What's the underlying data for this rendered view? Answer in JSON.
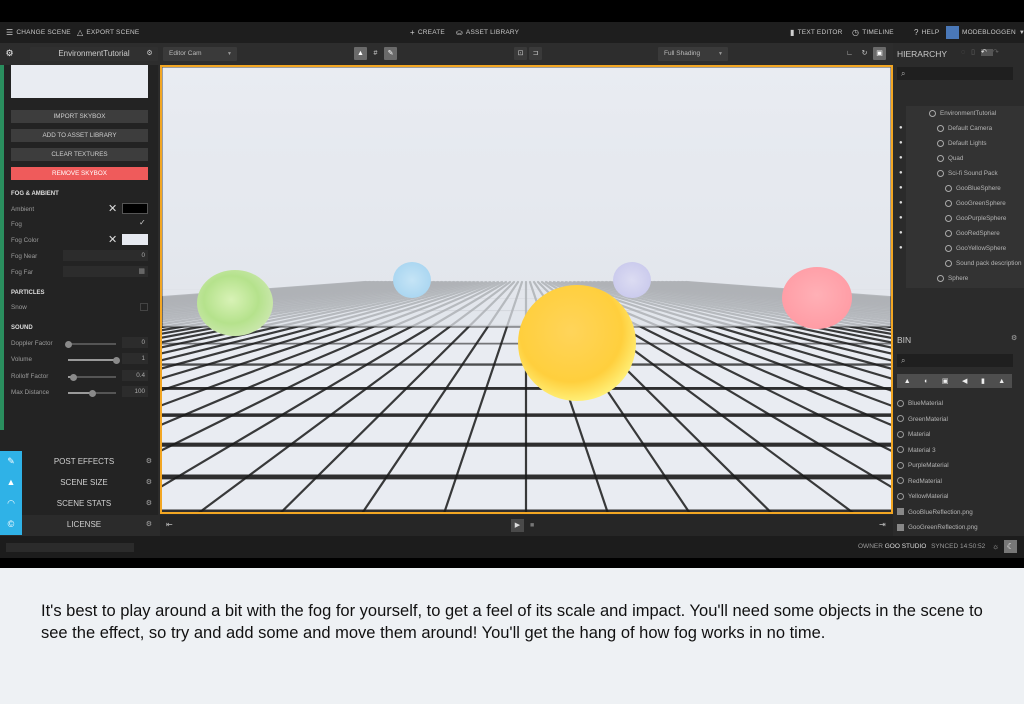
{
  "topbar": {
    "change_scene": "CHANGE SCENE",
    "export_scene": "EXPORT SCENE",
    "create": "CREATE",
    "asset_library": "ASSET LIBRARY",
    "text_editor": "TEXT EDITOR",
    "timeline": "TIMELINE",
    "help": "HELP",
    "user": "MODEBLOGGEN"
  },
  "subbar": {
    "scene_name": "EnvironmentTutorial",
    "camera": "Editor Cam",
    "shading": "Full Shading"
  },
  "left_panel": {
    "buttons": [
      "IMPORT SKYBOX",
      "ADD TO ASSET LIBRARY",
      "CLEAR TEXTURES",
      "REMOVE SKYBOX"
    ],
    "fog_section": "FOG & AMBIENT",
    "ambient_label": "Ambient",
    "ambient_color": "#000000",
    "fog_label": "Fog",
    "fog_checked": true,
    "fog_color_label": "Fog Color",
    "fog_color": "#e6e9f0",
    "fog_near_label": "Fog Near",
    "fog_near_value": "0",
    "fog_far_label": "Fog Far",
    "particles_section": "PARTICLES",
    "snow_label": "Snow",
    "snow_checked": false,
    "sound_section": "SOUND",
    "doppler_label": "Doppler Factor",
    "doppler_value": "0",
    "doppler_level": 0.0,
    "volume_label": "Volume",
    "volume_value": "1",
    "volume_level": 1.0,
    "rolloff_label": "Rolloff Factor",
    "rolloff_value": "0.4",
    "rolloff_level": 0.1,
    "maxdist_label": "Max Distance",
    "maxdist_value": "100",
    "maxdist_level": 0.5,
    "accordions": [
      {
        "label": "POST EFFECTS",
        "icon": "wand-icon"
      },
      {
        "label": "SCENE SIZE",
        "icon": "bell-icon"
      },
      {
        "label": "SCENE STATS",
        "icon": "gauge-icon"
      },
      {
        "label": "LICENSE",
        "icon": "copyright-icon"
      }
    ]
  },
  "hierarchy": {
    "title": "HIERARCHY",
    "items": [
      {
        "label": "EnvironmentTutorial",
        "depth": 0,
        "eye": false
      },
      {
        "label": "Default Camera",
        "depth": 1,
        "eye": true
      },
      {
        "label": "Default Lights",
        "depth": 1,
        "eye": true
      },
      {
        "label": "Quad",
        "depth": 1,
        "eye": true
      },
      {
        "label": "Sci-fi Sound Pack",
        "depth": 1,
        "eye": true
      },
      {
        "label": "GooBlueSphere",
        "depth": 2,
        "eye": true
      },
      {
        "label": "GooGreenSphere",
        "depth": 2,
        "eye": true
      },
      {
        "label": "GooPurpleSphere",
        "depth": 2,
        "eye": true
      },
      {
        "label": "GooRedSphere",
        "depth": 2,
        "eye": true
      },
      {
        "label": "GooYellowSphere",
        "depth": 2,
        "eye": true
      },
      {
        "label": "Sound pack description",
        "depth": 2,
        "eye": false
      },
      {
        "label": "Sphere",
        "depth": 1,
        "eye": false
      }
    ]
  },
  "bin": {
    "title": "BIN",
    "items": [
      {
        "label": "BlueMaterial",
        "kind": "material"
      },
      {
        "label": "GreenMaterial",
        "kind": "material"
      },
      {
        "label": "Material",
        "kind": "material"
      },
      {
        "label": "Material 3",
        "kind": "material"
      },
      {
        "label": "PurpleMaterial",
        "kind": "material"
      },
      {
        "label": "RedMaterial",
        "kind": "material"
      },
      {
        "label": "YellowMaterial",
        "kind": "material"
      },
      {
        "label": "GooBlueReflection.png",
        "kind": "image"
      },
      {
        "label": "GooGreenReflection.png",
        "kind": "image"
      }
    ]
  },
  "status": {
    "owner_label": "OWNER",
    "owner": "GOO STUDIO",
    "synced": "SYNCED 14:50:52"
  },
  "colors": {
    "accent_orange": "#f2a623",
    "danger_red": "#ef5b5b",
    "accordion_blue": "#2fb2e7",
    "stripe_green": "#2a8e5e"
  },
  "caption": "It's best to play around a bit with the fog for yourself, to get a feel of its scale and impact. You'll need some objects in the scene to see the effect, so try and add some and move them around! You'll get the hang of how fog works in no time."
}
